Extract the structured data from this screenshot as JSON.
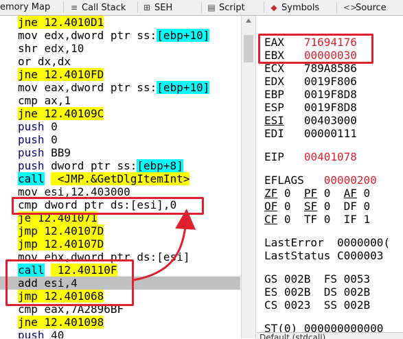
{
  "tabs": [
    {
      "label": "emory Map"
    },
    {
      "label": "Call Stack",
      "icon": "call-stack-icon"
    },
    {
      "label": "SEH",
      "icon": "seh-icon"
    },
    {
      "label": "Script",
      "icon": "script-icon"
    },
    {
      "label": "Symbols",
      "icon": "symbols-icon"
    },
    {
      "label": "Source",
      "icon": "source-icon"
    }
  ],
  "disasm": [
    {
      "op": "jne",
      "args": " 12.4010D1",
      "kind": "jump"
    },
    {
      "op": "mov",
      "pre": " edx,dword ptr ss:",
      "bracket": "[ebp+10]",
      "kind": "mem"
    },
    {
      "op": "shr",
      "args": " edx,10",
      "kind": "plain"
    },
    {
      "op": "or",
      "args": " dx,dx",
      "kind": "plain"
    },
    {
      "op": "jne",
      "args": " 12.4010FD",
      "kind": "jump"
    },
    {
      "op": "mov",
      "pre": " eax,dword ptr ss:",
      "bracket": "[ebp+10]",
      "kind": "mem"
    },
    {
      "op": "cmp",
      "args": " ax,1",
      "kind": "plain"
    },
    {
      "op": "jne",
      "args": " 12.40109C",
      "kind": "jump"
    },
    {
      "op": "push",
      "args": " 0",
      "kind": "push"
    },
    {
      "op": "push",
      "args": " 0",
      "kind": "push"
    },
    {
      "op": "push",
      "args": " BB9",
      "kind": "push"
    },
    {
      "op": "push",
      "pre": " dword ptr ss:",
      "bracket": "[ebp+8]",
      "kind": "pushmem"
    },
    {
      "op": "call",
      "args": " <JMP.&GetDlgItemInt>",
      "kind": "call"
    },
    {
      "op": "mov",
      "args": " esi,12.403000",
      "kind": "plain"
    },
    {
      "op": "cmp",
      "args": " dword ptr ds:[esi],0",
      "kind": "plain"
    },
    {
      "op": "je",
      "args": " 12.401071",
      "kind": "jump"
    },
    {
      "op": "jmp",
      "args": " 12.40107D",
      "kind": "jump"
    },
    {
      "op": "jmp",
      "args": " 12.40107D",
      "kind": "jump"
    },
    {
      "op": "mov",
      "pre": " ebx,dword ptr ds:",
      "bracket": "[esi]",
      "kind": "mem"
    },
    {
      "op": "call",
      "args": " 12.40110F",
      "kind": "call"
    },
    {
      "op": "add",
      "args": " esi,4",
      "kind": "plain"
    },
    {
      "op": "jmp",
      "args": " 12.401068",
      "kind": "jump"
    },
    {
      "op": "cmp",
      "args": " eax,7A2896BF",
      "kind": "plain"
    },
    {
      "op": "jne",
      "args": " 12.401098",
      "kind": "jump"
    },
    {
      "op": "push",
      "args": " 40",
      "kind": "push"
    }
  ],
  "registers": {
    "general": [
      {
        "name": "EAX",
        "value": "71694176",
        "changed": true
      },
      {
        "name": "EBX",
        "value": "00000030",
        "changed": true
      },
      {
        "name": "ECX",
        "value": "789A8586",
        "changed": false
      },
      {
        "name": "EDX",
        "value": "0019F806",
        "changed": false
      },
      {
        "name": "EBP",
        "value": "0019F8D8",
        "changed": false
      },
      {
        "name": "ESP",
        "value": "0019F8D8",
        "changed": false
      },
      {
        "name": "ESI",
        "value": "00403000",
        "changed": false
      },
      {
        "name": "EDI",
        "value": "00000111",
        "changed": false
      }
    ],
    "eip": {
      "name": "EIP",
      "value": "00401078"
    },
    "eflags": {
      "name": "EFLAGS",
      "value": "00000200"
    },
    "flags": [
      [
        {
          "n": "ZF",
          "v": "0"
        },
        {
          "n": "PF",
          "v": "0"
        },
        {
          "n": "AF",
          "v": "0"
        }
      ],
      [
        {
          "n": "OF",
          "v": "0"
        },
        {
          "n": "SF",
          "v": "0"
        },
        {
          "n": "DF",
          "v": "0"
        }
      ],
      [
        {
          "n": "CF",
          "v": "0"
        },
        {
          "n": "TF",
          "v": "0"
        },
        {
          "n": "IF",
          "v": "1"
        }
      ]
    ],
    "last_error": {
      "label": "LastError",
      "value": "0000000("
    },
    "last_status": {
      "label": "LastStatus",
      "value": "C000003"
    },
    "segments": [
      [
        {
          "n": "GS",
          "v": "002B"
        },
        {
          "n": "FS",
          "v": "0053"
        }
      ],
      [
        {
          "n": "ES",
          "v": "002B"
        },
        {
          "n": "DS",
          "v": "002B"
        }
      ],
      [
        {
          "n": "CS",
          "v": "0023"
        },
        {
          "n": "SS",
          "v": "002B"
        }
      ]
    ],
    "st0": "ST(0) 000000000000",
    "statusbar": "Default (stdcall)"
  },
  "colors": {
    "highlight": "#ffff00",
    "call": "#00ffff",
    "annotation": "#e0202e",
    "selected_row": "#c0c0c0"
  }
}
